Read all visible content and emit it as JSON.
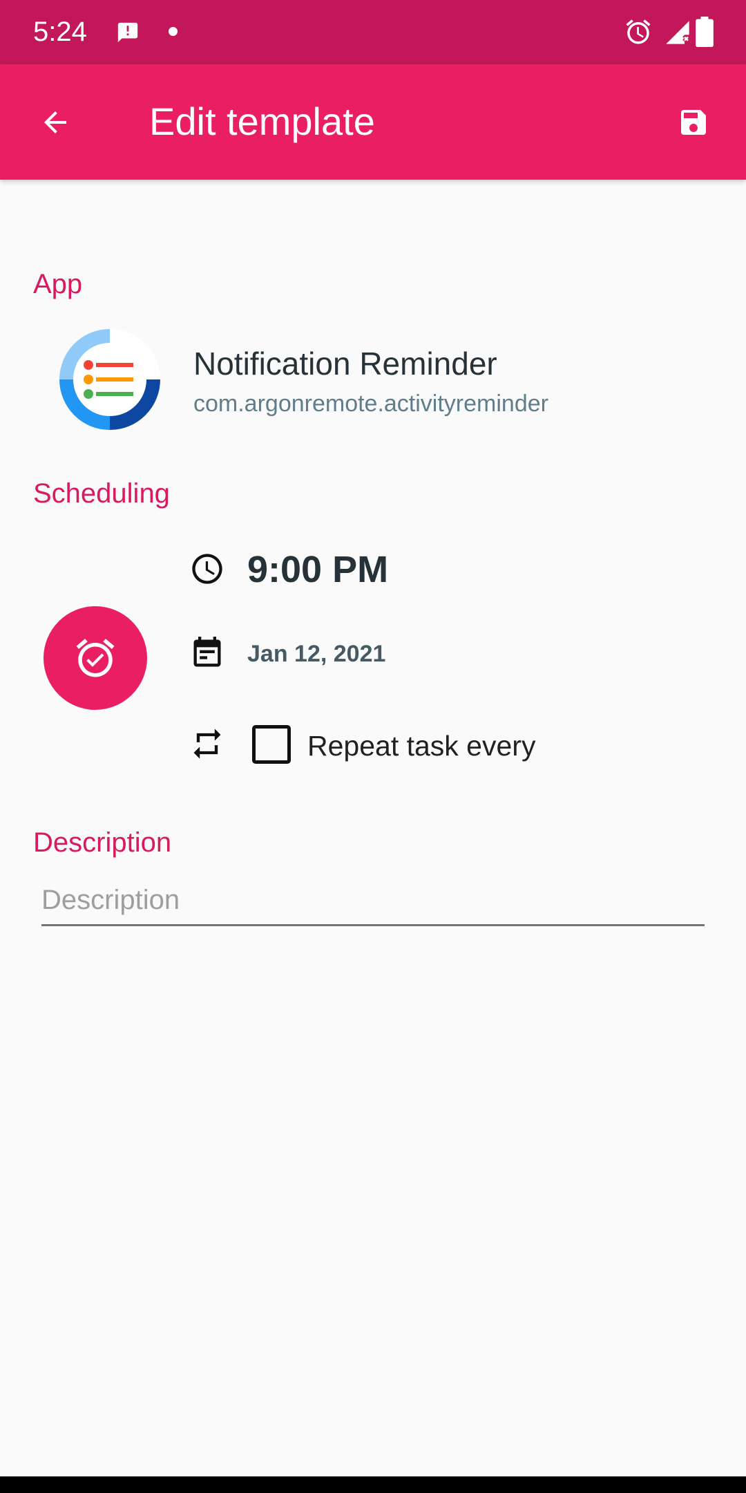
{
  "status_bar": {
    "time": "5:24",
    "left_icons": [
      "message-alert-icon",
      "dot-icon"
    ],
    "right_icons": [
      "alarm-icon",
      "signal-no-data-icon",
      "battery-icon"
    ],
    "color": "#C2185B"
  },
  "toolbar": {
    "back_icon": "arrow-back-icon",
    "title": "Edit template",
    "save_icon": "save-icon",
    "color": "#E91E63"
  },
  "app_section": {
    "label": "App",
    "app_name": "Notification Reminder",
    "package": "com.argonremote.activityreminder",
    "icon": "app-icon"
  },
  "scheduling_section": {
    "label": "Scheduling",
    "time": "9:00 PM",
    "date": "Jan 12, 2021",
    "repeat": {
      "label": "Repeat task every",
      "checked": false
    },
    "alarm_button_icon": "alarm-check-icon"
  },
  "description_section": {
    "label": "Description",
    "value": "",
    "placeholder": "Description"
  },
  "colors": {
    "accent": "#D81B60",
    "primary": "#E91E63",
    "primary_dark": "#C2185B"
  }
}
